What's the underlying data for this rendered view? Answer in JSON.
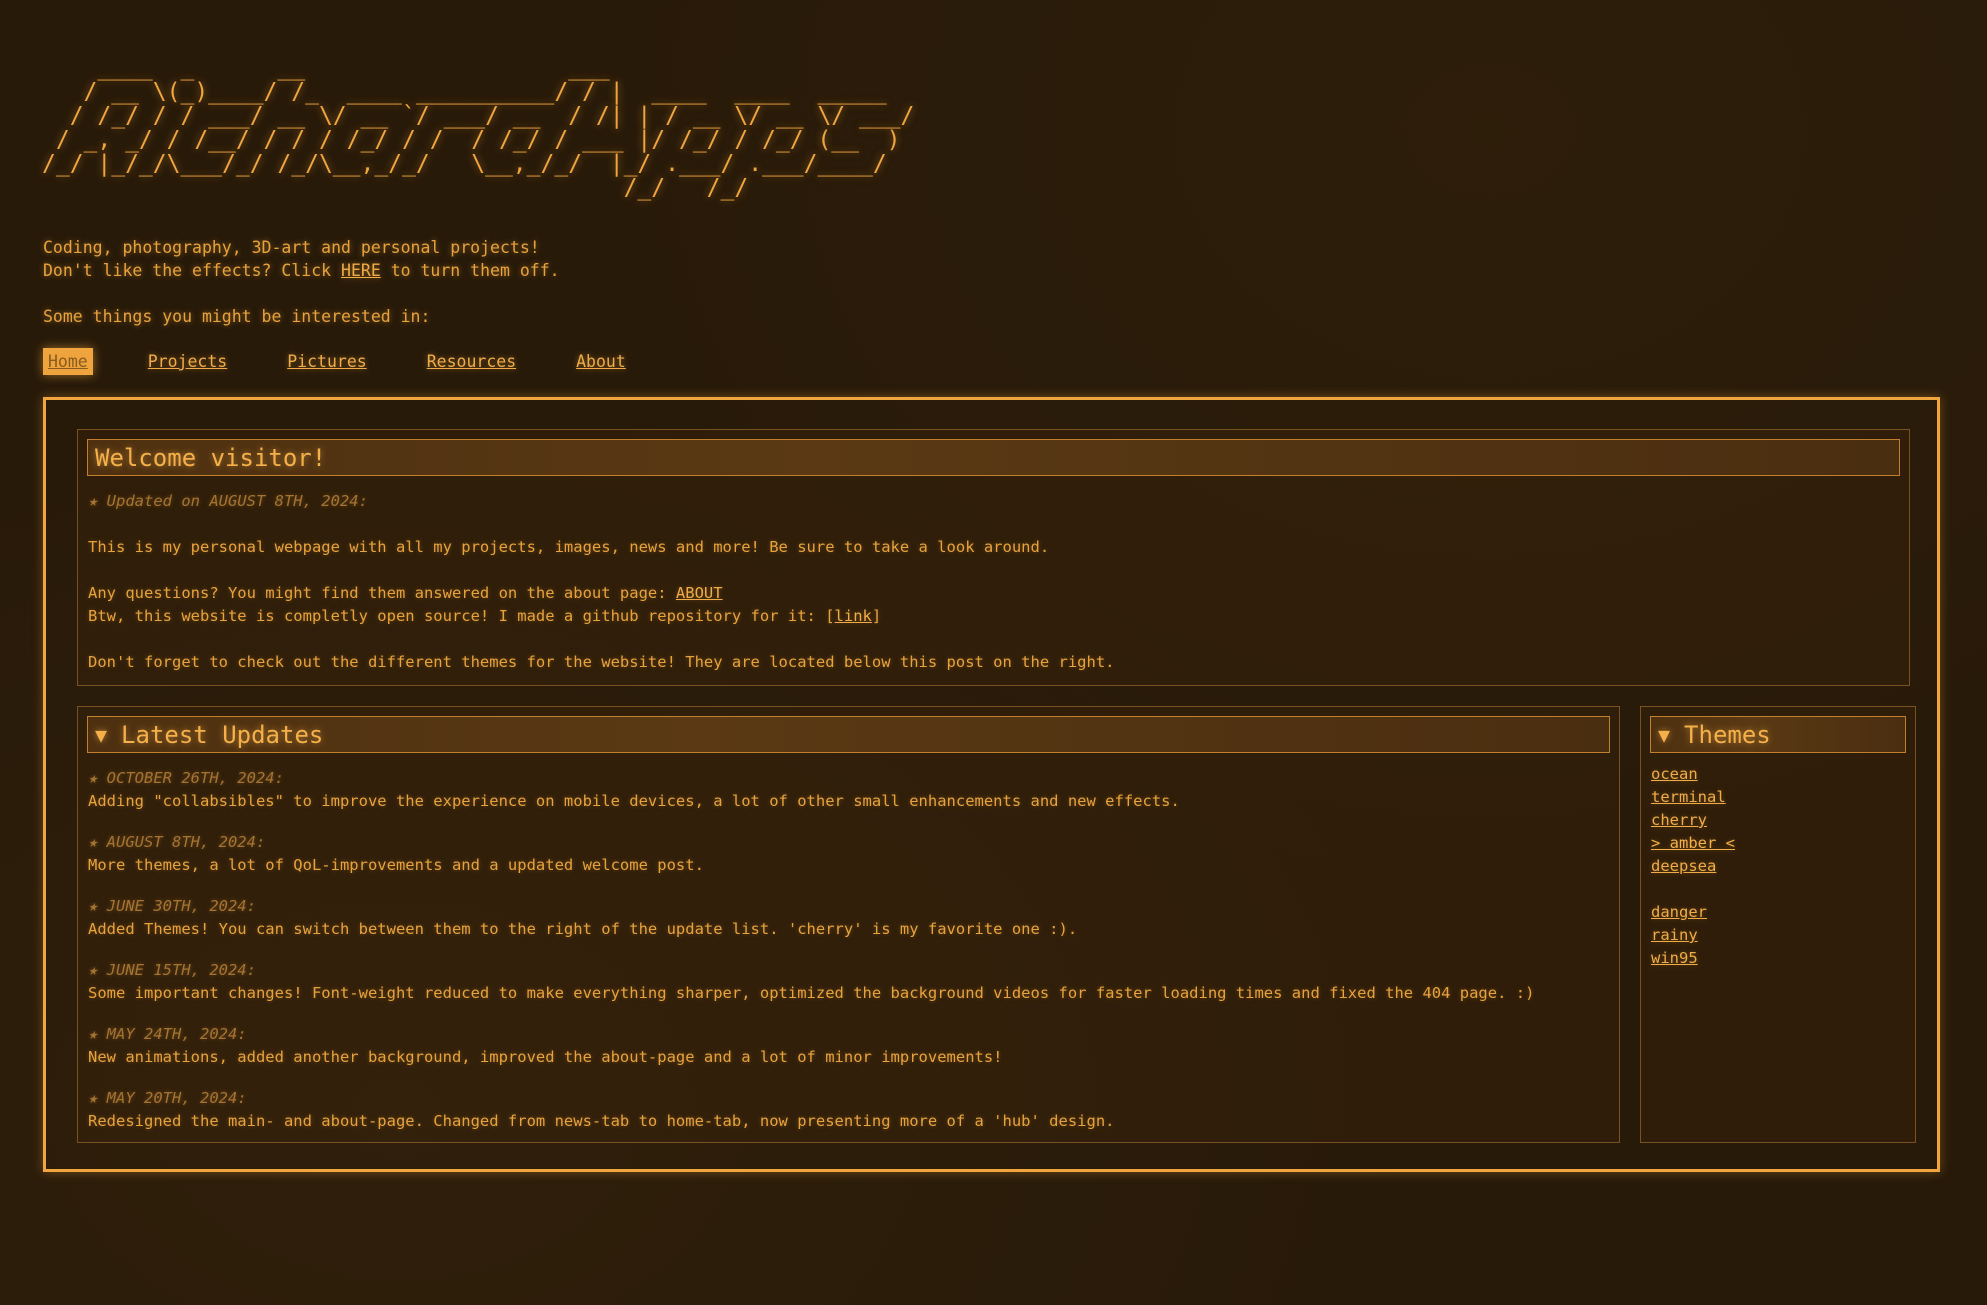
{
  "logo": {
    "ascii_lines": [
      "    ____  _      __                   ___                ",
      "   / __ \\(_)____/ /_  ____ __________/ / |  ____  ____  _____",
      "  / /_/ / / ___/ __ \\/ __ `/ ___/ __  / /| | / __ \\/ __ \\/ ___/",
      " / _, _/ / /__/ / / / /_/ / /  / /_/ / ___ |/ /_/ / /_/ (__  ) ",
      "/_/ |_/_/\\___/_/ /_/\\__,_/_/   \\__,_/_/  |_/ .___/ .___/____/  ",
      "                                          /_/   /_/            "
    ]
  },
  "intro": {
    "line1": "Coding, photography, 3D-art and personal projects!",
    "line2_prefix": "Don't like the effects? Click ",
    "line2_link": "HERE",
    "line2_suffix": " to turn them off.",
    "line3": "Some things you might be interested in:"
  },
  "nav": {
    "items": [
      {
        "label": "Home"
      },
      {
        "label": "Projects"
      },
      {
        "label": "Pictures"
      },
      {
        "label": "Resources"
      },
      {
        "label": "About"
      }
    ],
    "active": "Home"
  },
  "welcome": {
    "title": "Welcome visitor!",
    "updated": "★ Updated on AUGUST 8TH, 2024:",
    "p1": "This is my personal webpage with all my projects, images, news and more! Be sure to take a look around.",
    "p2_prefix": "Any questions? You might find them answered on the about page: ",
    "p2_link": "ABOUT",
    "p3_prefix": "Btw, this website is completly open source! I made a github repository for it: [",
    "p3_link": "link",
    "p3_suffix": "]",
    "p4": "Don't forget to check out the different themes for the website! They are located below this post on the right."
  },
  "updates": {
    "title": "Latest Updates",
    "toggle_icon": "▼",
    "entries": [
      {
        "date": "★ OCTOBER 26TH, 2024:",
        "text": "Adding \"collabsibles\" to improve the experience on mobile devices, a lot of other small enhancements and new effects."
      },
      {
        "date": "★ AUGUST 8TH, 2024:",
        "text": "More themes, a lot of QoL-improvements and a updated welcome post."
      },
      {
        "date": "★ JUNE 30TH, 2024:",
        "text": "Added Themes! You can switch between them to the right of the update list. 'cherry' is my favorite one :)."
      },
      {
        "date": "★ JUNE 15TH, 2024:",
        "text": "Some important changes! Font-weight reduced to make everything sharper, optimized the background videos for faster loading times and fixed the 404 page. :)"
      },
      {
        "date": "★ MAY 24TH, 2024:",
        "text": "New animations, added another background, improved the about-page and a lot of minor improvements!"
      },
      {
        "date": "★ MAY 20TH, 2024:",
        "text": "Redesigned the main- and about-page. Changed from news-tab to home-tab, now presenting more of a 'hub' design."
      }
    ]
  },
  "themes": {
    "title": "Themes",
    "toggle_icon": "▼",
    "group1": [
      "ocean",
      "terminal",
      "cherry",
      "> amber <",
      "deepsea"
    ],
    "group2": [
      "danger",
      "rainy",
      "win95"
    ],
    "selected": "amber"
  },
  "colors": {
    "background": "#281a09",
    "accent": "#f0a53e",
    "text": "#e8a23c",
    "muted": "#a57332"
  }
}
